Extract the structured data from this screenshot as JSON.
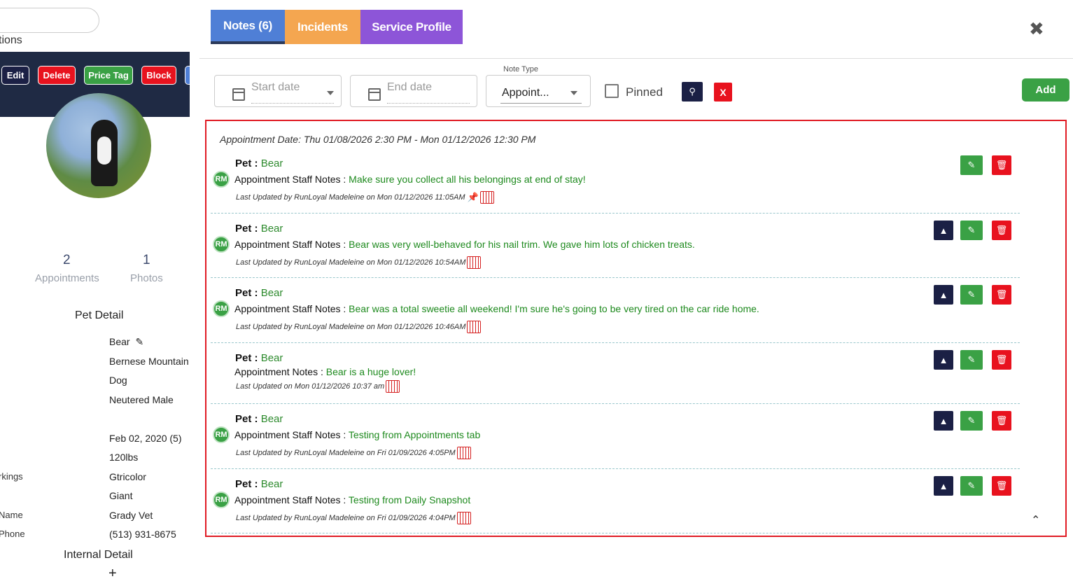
{
  "left": {
    "options_fragment": "tions",
    "buttons": {
      "edit": "Edit",
      "delete": "Delete",
      "price_tag": "Price Tag",
      "block": "Block"
    },
    "stats": [
      {
        "value": "2",
        "label": "Appointments"
      },
      {
        "value": "1",
        "label": "Photos"
      }
    ],
    "pet_detail_title": "Pet Detail",
    "pet_name": "Bear",
    "breed": "Bernese Mountain",
    "species": "Dog",
    "sex": "Neutered Male",
    "birthdate": "Feb 02, 2020  (5)",
    "weight": "120lbs",
    "markings_key": "rkings",
    "markings": "Gtricolor",
    "size": "Giant",
    "vet_name_key": "Name",
    "vet_name": "Grady Vet",
    "vet_phone_key": "Phone",
    "vet_phone": "(513) 931-8675",
    "internal_detail_title": "Internal Detail",
    "add_symbol": "+"
  },
  "tabs": {
    "notes": "Notes (6)",
    "incidents": "Incidents",
    "service": "Service Profile"
  },
  "filters": {
    "start_placeholder": "Start date",
    "end_placeholder": "End date",
    "note_type_label": "Note Type",
    "note_type_value": "Appoint...",
    "pinned_label": "Pinned",
    "clear_label": "X",
    "add_label": "Add"
  },
  "appointment_date": "Appointment Date: Thu 01/08/2026 2:30 PM - Mon 01/12/2026 12:30 PM",
  "notes": [
    {
      "pet_label": "Pet : ",
      "pet": "Bear",
      "type_label": "Appointment Staff Notes : ",
      "text": "Make sure you collect all his belongings at end of stay!",
      "updated": "Last Updated by RunLoyal Madeleine on Mon 01/12/2026 11:05AM",
      "avatar": "RM"
    },
    {
      "pet_label": "Pet : ",
      "pet": "Bear",
      "type_label": "Appointment Staff Notes : ",
      "text": "Bear was very well-behaved for his nail trim. We gave him lots of chicken treats.",
      "updated": "Last Updated by RunLoyal Madeleine on Mon 01/12/2026 10:54AM",
      "avatar": "RM"
    },
    {
      "pet_label": "Pet : ",
      "pet": "Bear",
      "type_label": "Appointment Staff Notes : ",
      "text": "Bear was a total sweetie all weekend! I'm sure he's going to be very tired on the car ride home.",
      "updated": "Last Updated by RunLoyal Madeleine on Mon 01/12/2026 10:46AM",
      "avatar": "RM"
    },
    {
      "pet_label": "Pet : ",
      "pet": "Bear",
      "type_label": "Appointment Notes : ",
      "text": "Bear is a huge lover!",
      "updated": "Last Updated on Mon 01/12/2026 10:37 am",
      "avatar": ""
    },
    {
      "pet_label": "Pet : ",
      "pet": "Bear",
      "type_label": "Appointment Staff Notes : ",
      "text": "Testing from Appointments tab",
      "updated": "Last Updated by RunLoyal Madeleine on Fri 01/09/2026 4:05PM",
      "avatar": "RM"
    },
    {
      "pet_label": "Pet : ",
      "pet": "Bear",
      "type_label": "Appointment Staff Notes : ",
      "text": "Testing from Daily Snapshot",
      "updated": "Last Updated by RunLoyal Madeleine on Fri 01/09/2026 4:04PM",
      "avatar": "RM"
    }
  ],
  "colors": {
    "notes_tab": "#4f7fd6",
    "incidents_tab": "#f4a650",
    "service_tab": "#8d55d8",
    "highlight_border": "#e01b24",
    "note_text": "#1e8a1e"
  }
}
